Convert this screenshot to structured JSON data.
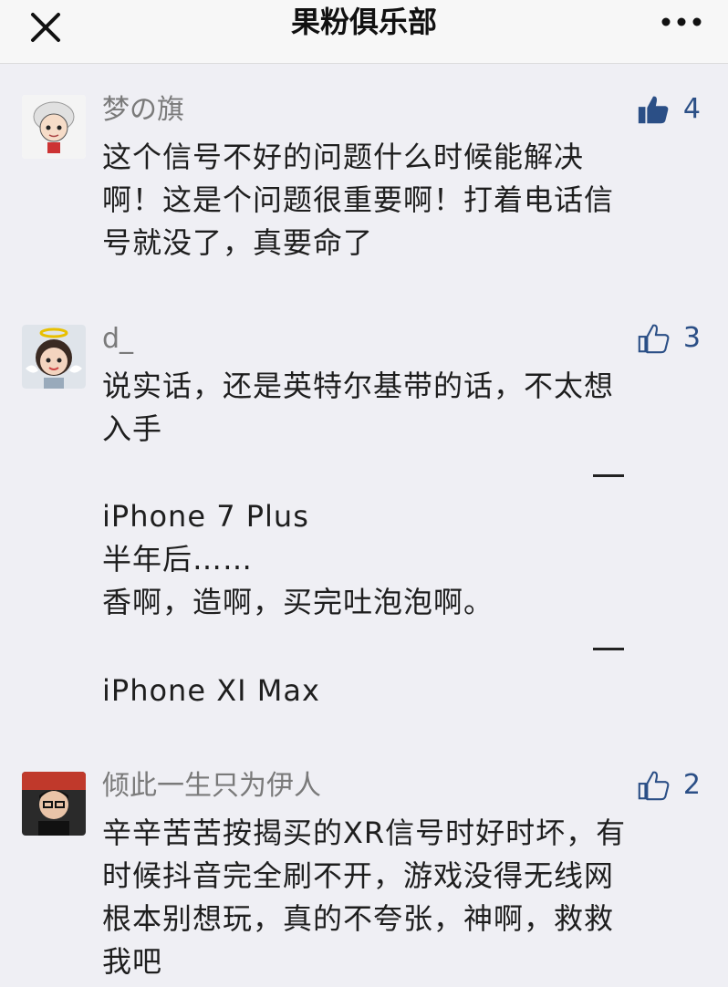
{
  "nav": {
    "title": "果粉俱乐部",
    "close_icon": "close-icon",
    "more_icon": "more-dots-icon"
  },
  "comments": [
    {
      "username": "梦の旗",
      "likes": "4",
      "liked": true,
      "lines": [
        "这个信号不好的问题什么时候能解决",
        "啊！这是个问题很重要啊！打着电话信",
        "号就没了，真要命了"
      ]
    },
    {
      "username": "d_",
      "likes": "3",
      "liked": false,
      "lines": [
        "说实话，还是英特尔基带的话，不太想",
        "入手"
      ],
      "dash1": "—",
      "lines2": [
        "iPhone 7 Plus",
        "半年后……",
        "香啊，造啊，买完吐泡泡啊。"
      ],
      "dash2": "—",
      "lines3": [
        "iPhone XI Max"
      ]
    },
    {
      "username": "倾此一生只为伊人",
      "likes": "2",
      "liked": false,
      "lines": [
        "辛辛苦苦按揭买的XR信号时好时坏，有",
        "时候抖音完全刷不开，游戏没得无线网",
        "根本别想玩，真的不夸张，神啊，救救",
        "我吧"
      ]
    }
  ],
  "colors": {
    "background": "#efeff4",
    "like_blue": "#2b4f86",
    "username_gray": "#7a7a7a"
  }
}
